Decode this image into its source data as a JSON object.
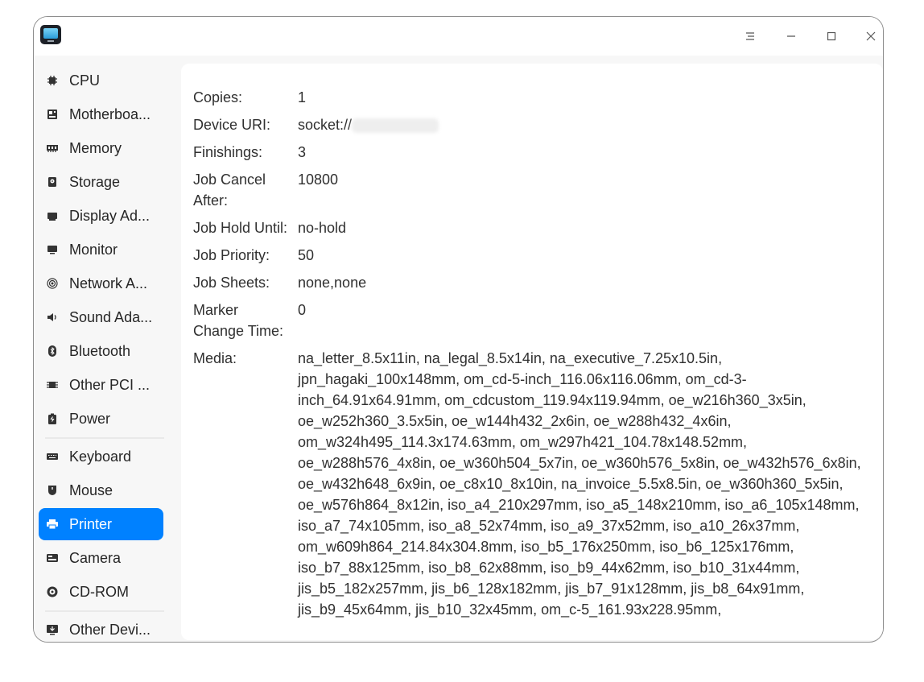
{
  "sidebar": {
    "items": [
      {
        "label": "CPU",
        "icon": "cpu-icon"
      },
      {
        "label": "Motherboa...",
        "icon": "motherboard-icon"
      },
      {
        "label": "Memory",
        "icon": "memory-icon"
      },
      {
        "label": "Storage",
        "icon": "storage-icon"
      },
      {
        "label": "Display Ad...",
        "icon": "display-adapter-icon"
      },
      {
        "label": "Monitor",
        "icon": "monitor-icon"
      },
      {
        "label": "Network A...",
        "icon": "network-icon"
      },
      {
        "label": "Sound Ada...",
        "icon": "sound-icon"
      },
      {
        "label": "Bluetooth",
        "icon": "bluetooth-icon"
      },
      {
        "label": "Other PCI ...",
        "icon": "pci-icon"
      },
      {
        "label": "Power",
        "icon": "power-icon"
      },
      {
        "label": "Keyboard",
        "icon": "keyboard-icon"
      },
      {
        "label": "Mouse",
        "icon": "mouse-icon"
      },
      {
        "label": "Printer",
        "icon": "printer-icon",
        "selected": true
      },
      {
        "label": "Camera",
        "icon": "camera-icon"
      },
      {
        "label": "CD-ROM",
        "icon": "cdrom-icon"
      },
      {
        "label": "Other Devi...",
        "icon": "other-devices-icon"
      }
    ]
  },
  "details": {
    "copies": {
      "label": "Copies:",
      "value": "1"
    },
    "device_uri": {
      "label": "Device URI:",
      "value": "socket://"
    },
    "finishings": {
      "label": "Finishings:",
      "value": "3"
    },
    "job_cancel_after": {
      "label": "Job Cancel After:",
      "value": "10800"
    },
    "job_hold_until": {
      "label": "Job Hold Until:",
      "value": "no-hold"
    },
    "job_priority": {
      "label": "Job Priority:",
      "value": "50"
    },
    "job_sheets": {
      "label": "Job Sheets:",
      "value": "none,none"
    },
    "marker_change_time": {
      "label": "Marker Change Time:",
      "value": "0"
    },
    "media": {
      "label": "Media:",
      "lines": [
        "na_letter_8.5x11in, na_legal_8.5x14in, na_executive_7.25x10.5in,",
        "jpn_hagaki_100x148mm, om_cd-5-inch_116.06x116.06mm, om_cd-3-",
        "inch_64.91x64.91mm, om_cdcustom_119.94x119.94mm, oe_w216h360_3x5in,",
        "oe_w252h360_3.5x5in, oe_w144h432_2x6in, oe_w288h432_4x6in,",
        "om_w324h495_114.3x174.63mm, om_w297h421_104.78x148.52mm,",
        "oe_w288h576_4x8in, oe_w360h504_5x7in, oe_w360h576_5x8in, oe_w432h576_6x8in,",
        "oe_w432h648_6x9in, oe_c8x10_8x10in, na_invoice_5.5x8.5in, oe_w360h360_5x5in,",
        "oe_w576h864_8x12in, iso_a4_210x297mm, iso_a5_148x210mm, iso_a6_105x148mm,",
        "iso_a7_74x105mm, iso_a8_52x74mm, iso_a9_37x52mm, iso_a10_26x37mm,",
        "om_w609h864_214.84x304.8mm, iso_b5_176x250mm, iso_b6_125x176mm,",
        "iso_b7_88x125mm, iso_b8_62x88mm, iso_b9_44x62mm, iso_b10_31x44mm,",
        "jis_b5_182x257mm, jis_b6_128x182mm, jis_b7_91x128mm, jis_b8_64x91mm,",
        "jis_b9_45x64mm, jis_b10_32x45mm, om_c-5_161.93x228.95mm,"
      ]
    }
  },
  "colors": {
    "accent": "#0081ff",
    "sidebar_bg": "#f7f7f7",
    "content_bg": "#ffffff"
  }
}
